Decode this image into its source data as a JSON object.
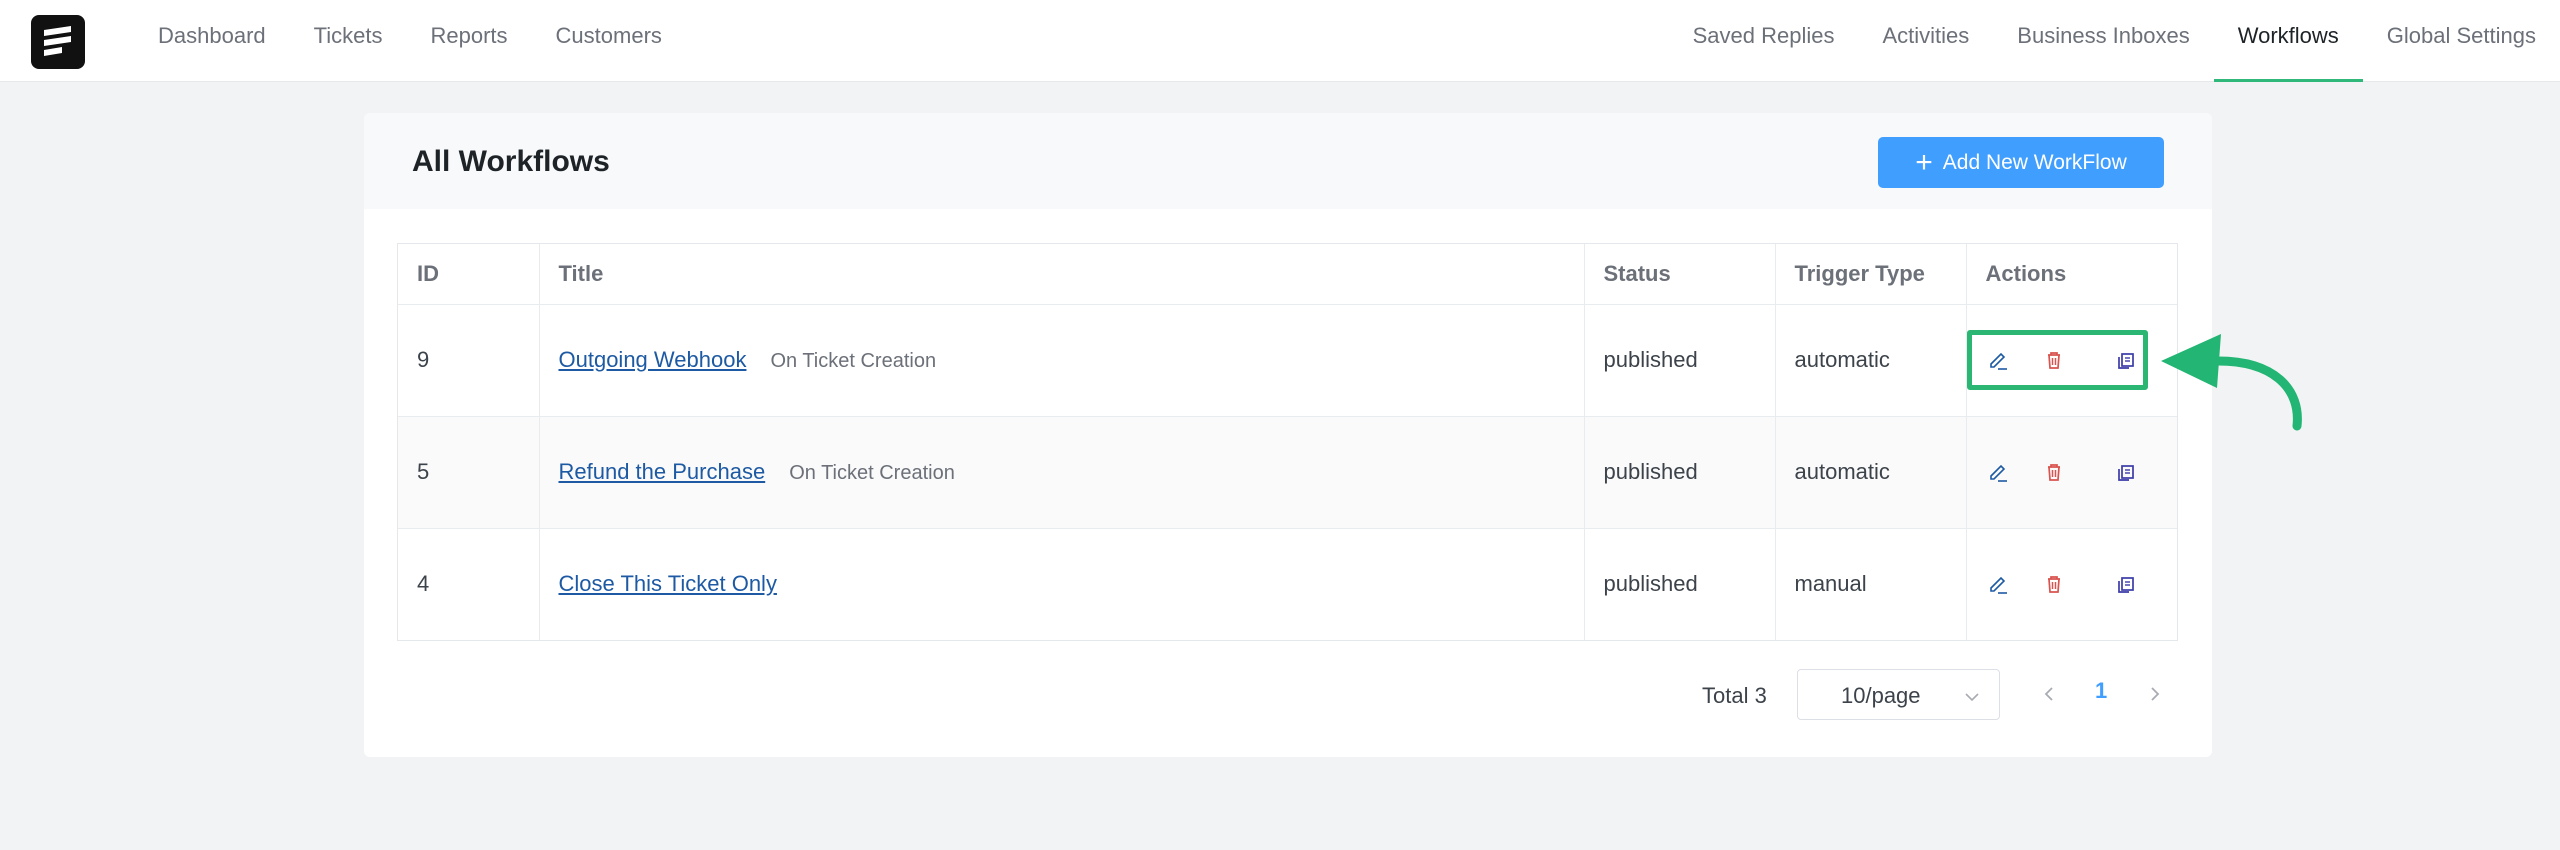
{
  "nav": {
    "left": [
      "Dashboard",
      "Tickets",
      "Reports",
      "Customers"
    ],
    "right": [
      "Saved Replies",
      "Activities",
      "Business Inboxes",
      "Workflows",
      "Global Settings"
    ],
    "active": "Workflows"
  },
  "page": {
    "title": "All Workflows",
    "add_button": "Add New WorkFlow"
  },
  "table": {
    "columns": [
      "ID",
      "Title",
      "Status",
      "Trigger Type",
      "Actions"
    ],
    "rows": [
      {
        "id": "9",
        "title": "Outgoing Webhook",
        "trigger_label": "On Ticket Creation",
        "status": "published",
        "trigger_type": "automatic"
      },
      {
        "id": "5",
        "title": "Refund the Purchase",
        "trigger_label": "On Ticket Creation",
        "status": "published",
        "trigger_type": "automatic"
      },
      {
        "id": "4",
        "title": "Close This Ticket Only",
        "trigger_label": "",
        "status": "published",
        "trigger_type": "manual"
      }
    ]
  },
  "pagination": {
    "total": "Total 3",
    "page_size": "10/page",
    "current_page": "1"
  },
  "colors": {
    "accent": "#409eff",
    "highlight": "#2cb673",
    "delete": "#d9534f",
    "duplicate": "#3b3ba8",
    "link": "#1d5aa3"
  }
}
